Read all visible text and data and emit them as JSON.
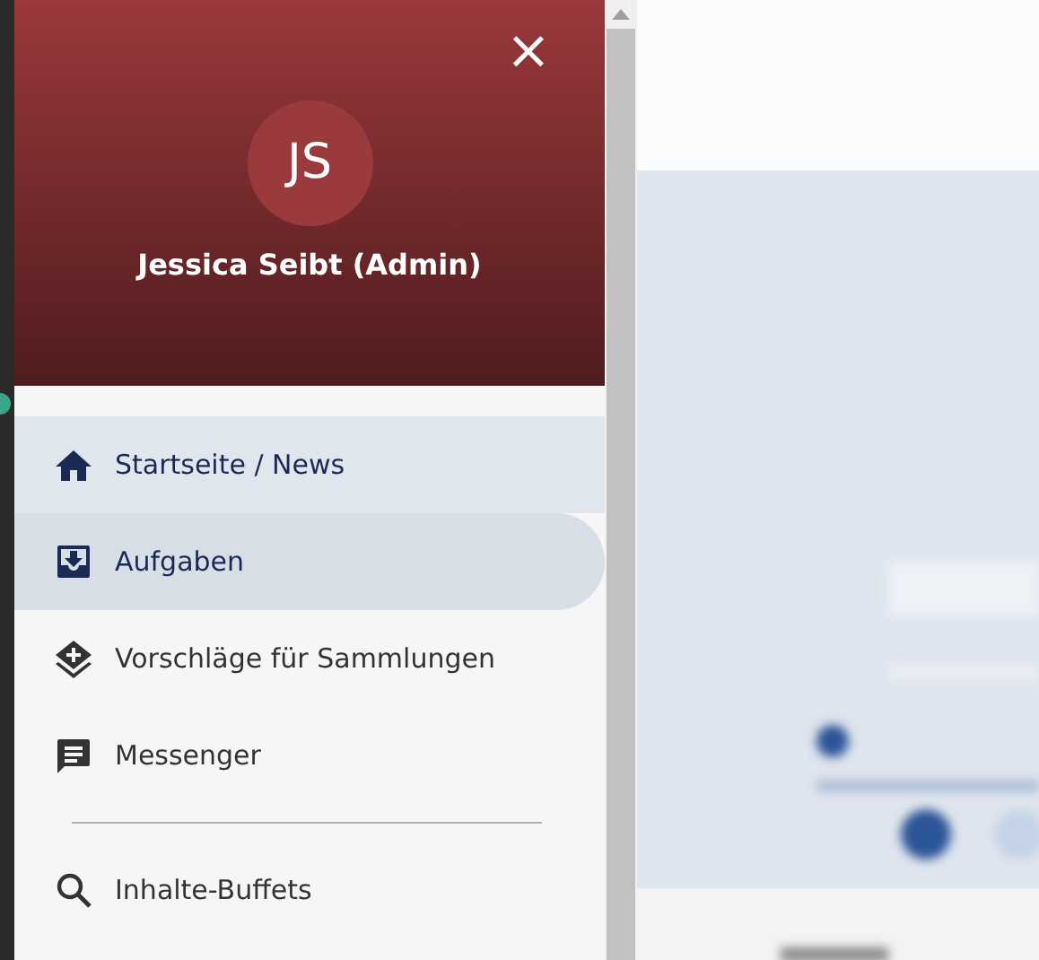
{
  "drawer": {
    "close": "×",
    "avatar_initials": "JS",
    "user_name": "Jessica Seibt (Admin)",
    "groups": [
      [
        {
          "kind": "home",
          "label": "Startseite / News",
          "selected": true,
          "hovered": false
        },
        {
          "kind": "inbox",
          "label": "Aufgaben",
          "selected": false,
          "hovered": true
        },
        {
          "kind": "layers",
          "label": "Vorschläge für Sammlungen",
          "selected": false,
          "hovered": false
        },
        {
          "kind": "chat",
          "label": "Messenger",
          "selected": false,
          "hovered": false
        }
      ],
      [
        {
          "kind": "search",
          "label": "Inhalte-Buffets",
          "selected": false,
          "hovered": false
        }
      ]
    ]
  }
}
